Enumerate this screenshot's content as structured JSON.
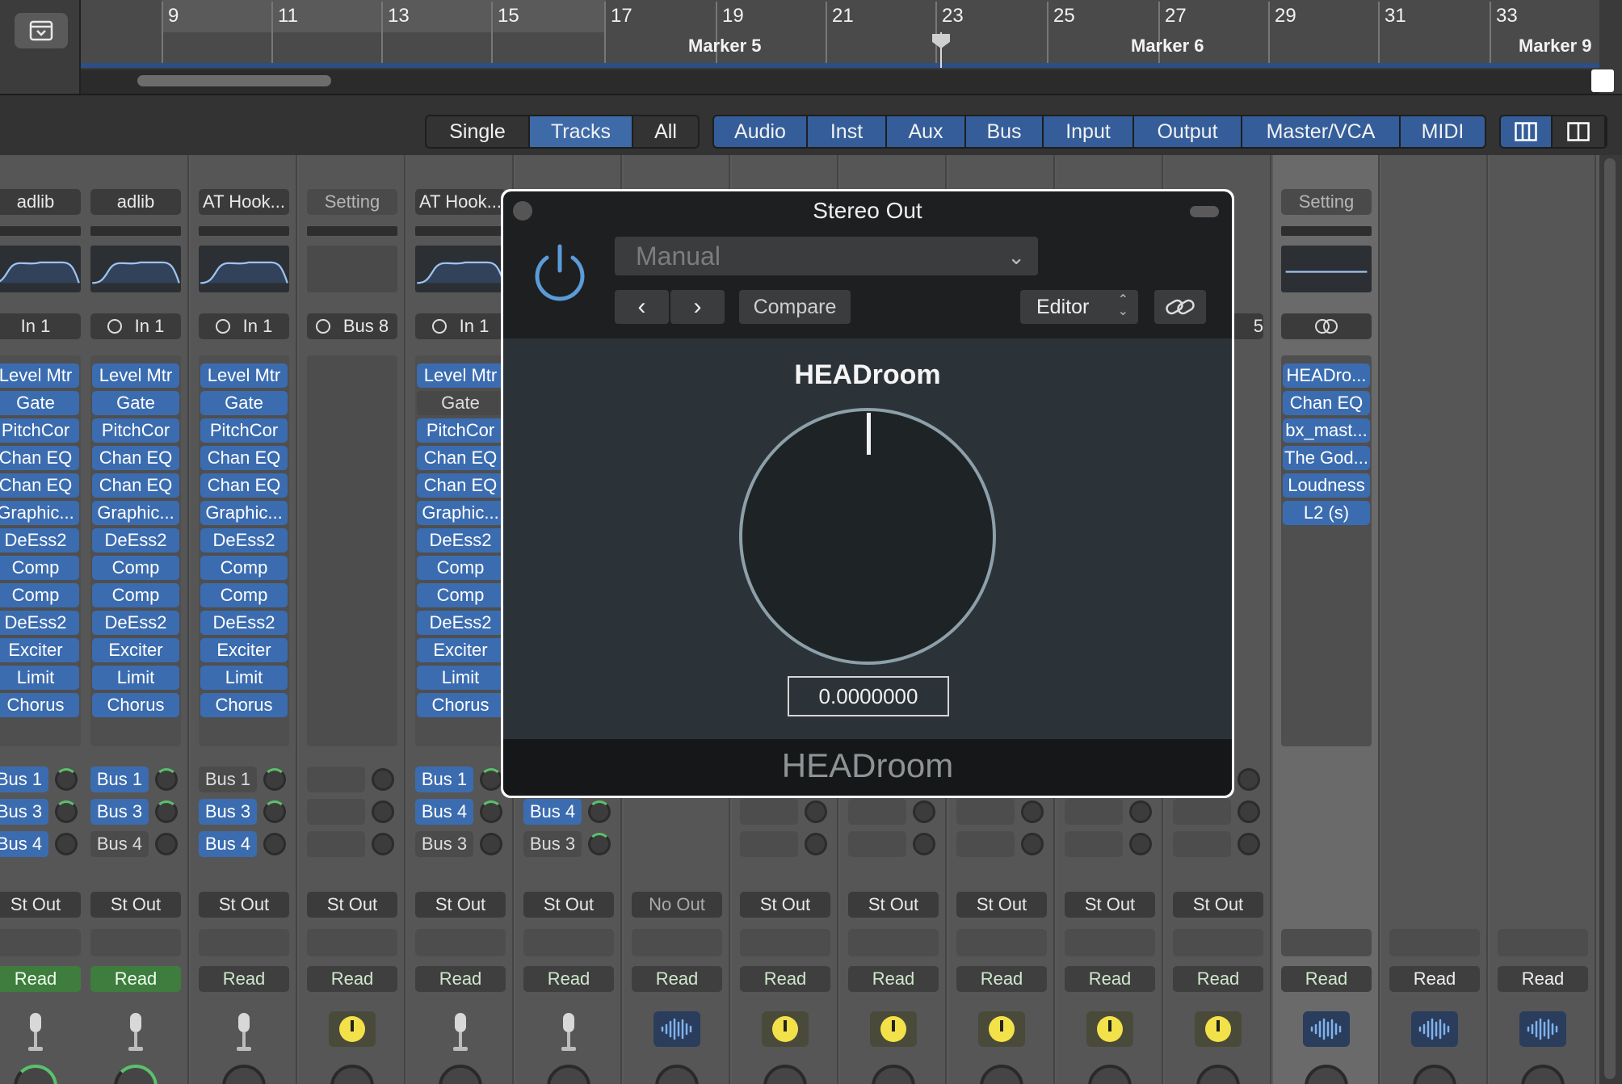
{
  "ruler": {
    "bars": [
      "9",
      "11",
      "13",
      "15",
      "17",
      "19",
      "21",
      "23",
      "25",
      "27",
      "29",
      "31",
      "33"
    ],
    "markers": [
      "Marker 5",
      "Marker 6",
      "Marker 9"
    ]
  },
  "toolbar": {
    "view_modes": [
      "Single",
      "Tracks",
      "All"
    ],
    "selected_view": "Tracks",
    "filters": [
      "Audio",
      "Inst",
      "Aux",
      "Bus",
      "Input",
      "Output",
      "Master/VCA",
      "MIDI"
    ]
  },
  "strips": [
    {
      "setting": "adlib",
      "input": "In 1",
      "plugins": [
        "Level Mtr",
        "Gate",
        "PitchCor",
        "Chan EQ",
        "Chan EQ",
        "Graphic...",
        "DeEss2",
        "Comp",
        "Comp",
        "DeEss2",
        "Exciter",
        "Limit",
        "Chorus"
      ],
      "sends": [
        "Bus 1",
        "Bus 3",
        "Bus 4"
      ],
      "output": "St Out",
      "automation": "Read"
    },
    {
      "setting": "adlib",
      "input": "In 1",
      "plugins": [
        "Level Mtr",
        "Gate",
        "PitchCor",
        "Chan EQ",
        "Chan EQ",
        "Graphic...",
        "DeEss2",
        "Comp",
        "Comp",
        "DeEss2",
        "Exciter",
        "Limit",
        "Chorus"
      ],
      "sends": [
        "Bus 1",
        "Bus 3",
        "Bus 4"
      ],
      "output": "St Out",
      "automation": "Read"
    },
    {
      "setting": "AT Hook...",
      "input": "In 1",
      "plugins": [
        "Level Mtr",
        "Gate",
        "PitchCor",
        "Chan EQ",
        "Chan EQ",
        "Graphic...",
        "DeEss2",
        "Comp",
        "Comp",
        "DeEss2",
        "Exciter",
        "Limit",
        "Chorus"
      ],
      "sends": [
        "Bus 1",
        "Bus 3",
        "Bus 4"
      ],
      "output": "St Out",
      "automation": "Read"
    },
    {
      "setting": "Setting",
      "input": "Bus 8",
      "plugins": [],
      "sends": [],
      "output": "St Out",
      "automation": "Read"
    },
    {
      "setting": "AT Hook...",
      "input": "In 1",
      "plugins": [
        "Level Mtr",
        "Gate",
        "PitchCor",
        "Chan EQ",
        "Chan EQ",
        "Graphic...",
        "DeEss2",
        "Comp",
        "Comp",
        "DeEss2",
        "Exciter",
        "Limit",
        "Chorus"
      ],
      "sends": [
        "Bus 1",
        "Bus 4",
        "Bus 3"
      ],
      "output": "St Out",
      "automation": "Read"
    },
    {
      "sends": [
        "Bus 4",
        "Bus 3"
      ],
      "output": "St Out",
      "automation": "Read"
    },
    {
      "output": "No Out",
      "automation": "Read"
    },
    {
      "output": "St Out",
      "automation": "Read"
    },
    {
      "output": "St Out",
      "automation": "Read"
    },
    {
      "output": "St Out",
      "automation": "Read"
    },
    {
      "output": "St Out",
      "automation": "Read"
    },
    {
      "output": "St Out",
      "automation": "Read",
      "input": "5"
    },
    {
      "setting": "Setting",
      "plugins": [
        "HEADro...",
        "Chan EQ",
        "bx_mast...",
        "The God...",
        "Loudness",
        "L2 (s)"
      ],
      "automation": "Read"
    },
    {
      "automation": "Read"
    },
    {
      "automation": "Read"
    }
  ],
  "plugin_window": {
    "title": "Stereo Out",
    "preset": "Manual",
    "compare_label": "Compare",
    "view_label": "Editor",
    "plugin_name": "HEADroom",
    "value": "0.0000000",
    "footer": "HEADroom",
    "accent": "#5b9bd8"
  }
}
